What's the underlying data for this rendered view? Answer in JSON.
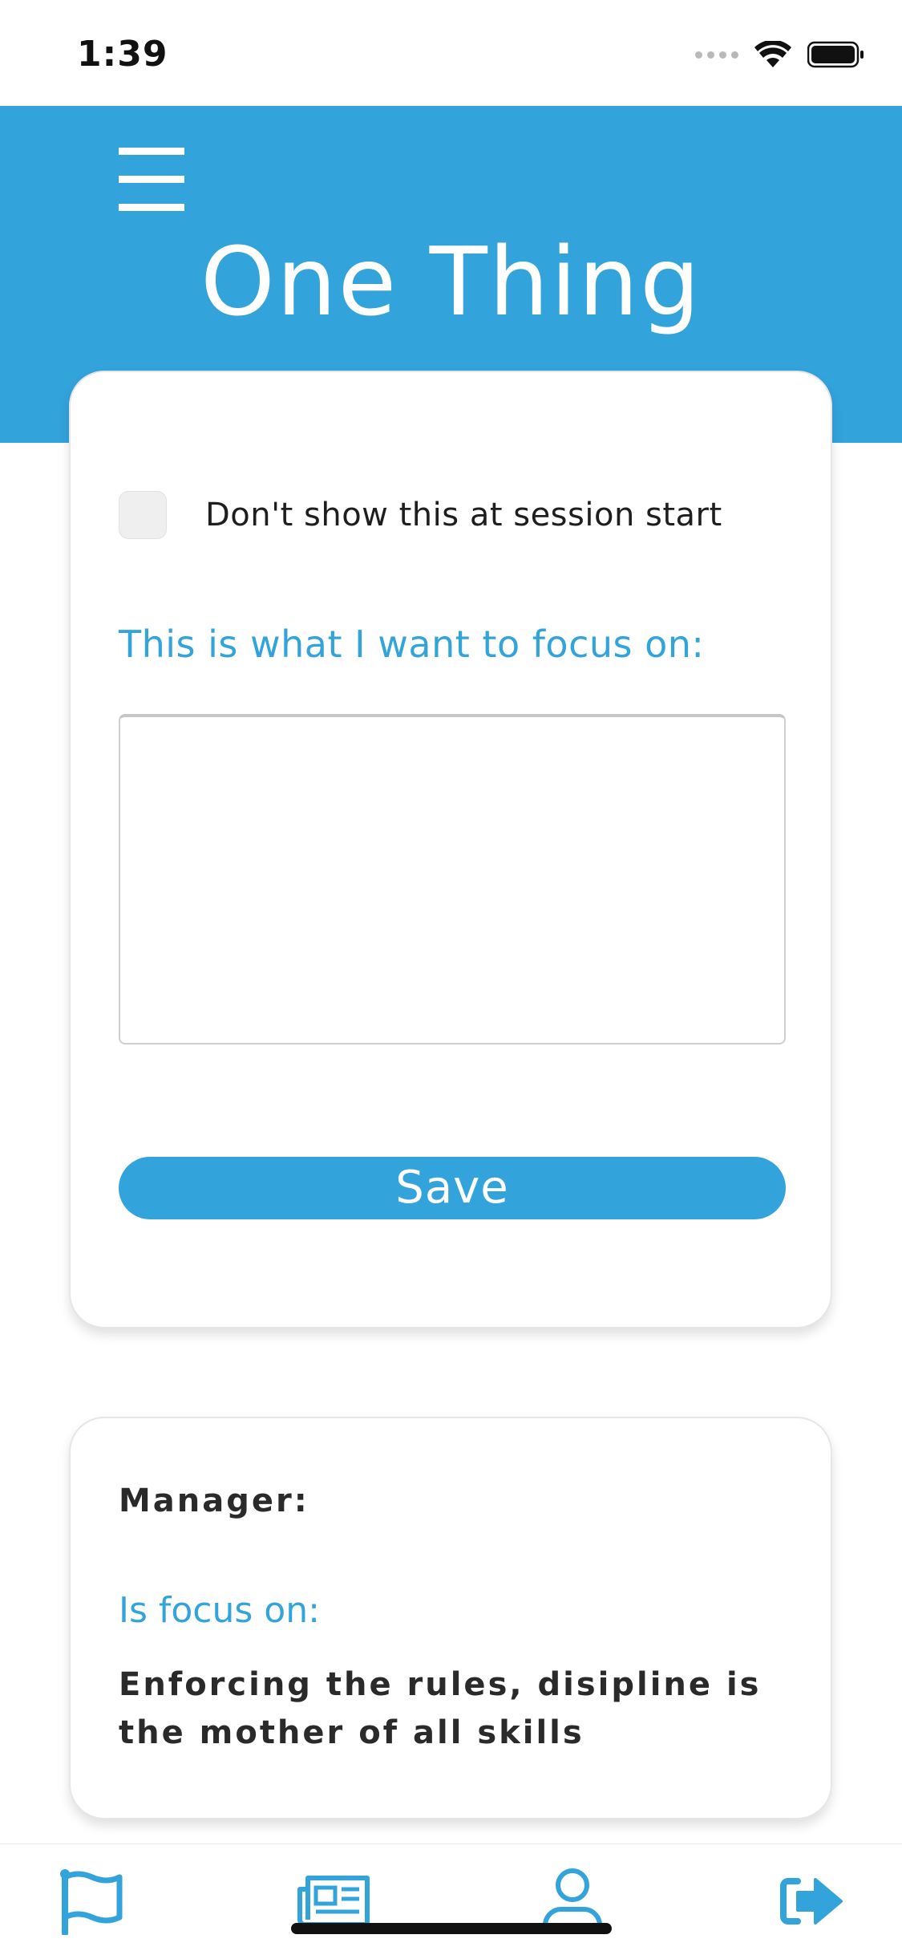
{
  "status_bar": {
    "time": "1:39"
  },
  "header": {
    "title": "One Thing"
  },
  "focus_card": {
    "checkbox_label": "Don't show this at session start",
    "focus_label": "This is what I want to focus on:",
    "textarea_value": "",
    "save_label": "Save"
  },
  "manager_card": {
    "manager_label": "Manager:",
    "focus_label": "Is focus on:",
    "focus_text": "Enforcing the rules, disipline is the mother of all skills"
  },
  "tab_bar": {
    "items": [
      {
        "icon": "flag-icon"
      },
      {
        "icon": "newspaper-icon"
      },
      {
        "icon": "user-icon"
      },
      {
        "icon": "logout-icon"
      }
    ]
  },
  "colors": {
    "accent": "#33a3dc",
    "background": "#ffffff",
    "text_dark": "#2a2a2a"
  }
}
